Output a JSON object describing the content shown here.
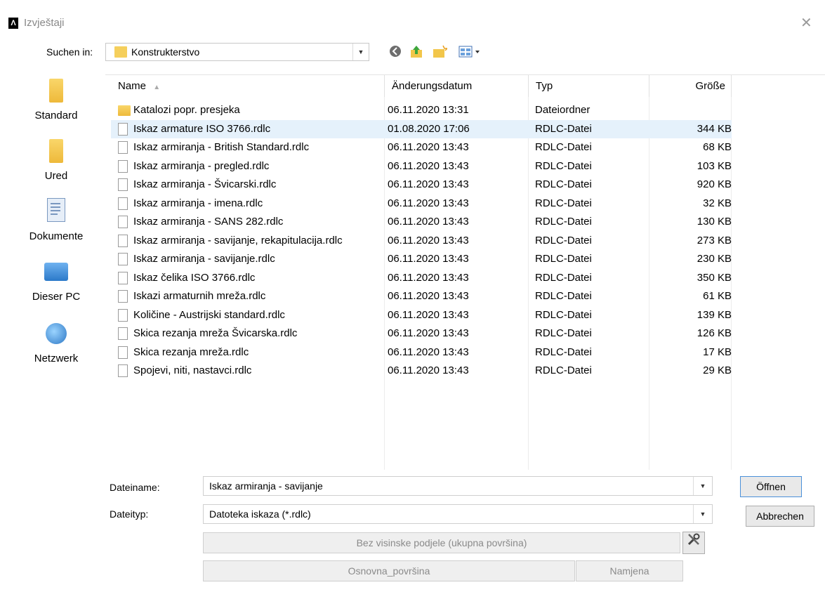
{
  "window": {
    "title": "Izvještaji",
    "app_icon": "Λ",
    "close_label": "✕"
  },
  "lookin": {
    "label": "Suchen in:",
    "value": "Konstrukterstvo"
  },
  "toolbar": {
    "back_icon": "back-icon",
    "up_icon": "up-folder-icon",
    "newfolder_icon": "new-folder-icon",
    "view_icon": "view-menu-icon"
  },
  "places": [
    {
      "label": "Standard",
      "icon": "folder-icon"
    },
    {
      "label": "Ured",
      "icon": "folder-icon"
    },
    {
      "label": "Dokumente",
      "icon": "documents-icon"
    },
    {
      "label": "Dieser PC",
      "icon": "computer-icon"
    },
    {
      "label": "Netzwerk",
      "icon": "network-icon"
    }
  ],
  "columns": {
    "name": "Name",
    "date": "Änderungsdatum",
    "type": "Typ",
    "size": "Größe"
  },
  "files": [
    {
      "name": "Katalozi popr. presjeka",
      "date": "06.11.2020 13:31",
      "type": "Dateiordner",
      "size": "",
      "kind": "folder"
    },
    {
      "name": "Iskaz armature ISO 3766.rdlc",
      "date": "01.08.2020 17:06",
      "type": "RDLC-Datei",
      "size": "344 KB",
      "kind": "file"
    },
    {
      "name": "Iskaz armiranja -  British Standard.rdlc",
      "date": "06.11.2020 13:43",
      "type": "RDLC-Datei",
      "size": "68 KB",
      "kind": "file"
    },
    {
      "name": "Iskaz armiranja -  pregled.rdlc",
      "date": "06.11.2020 13:43",
      "type": "RDLC-Datei",
      "size": "103 KB",
      "kind": "file"
    },
    {
      "name": "Iskaz armiranja -  Švicarski.rdlc",
      "date": "06.11.2020 13:43",
      "type": "RDLC-Datei",
      "size": "920 KB",
      "kind": "file"
    },
    {
      "name": "Iskaz armiranja - imena.rdlc",
      "date": "06.11.2020 13:43",
      "type": "RDLC-Datei",
      "size": "32 KB",
      "kind": "file"
    },
    {
      "name": "Iskaz armiranja - SANS 282.rdlc",
      "date": "06.11.2020 13:43",
      "type": "RDLC-Datei",
      "size": "130 KB",
      "kind": "file"
    },
    {
      "name": "Iskaz armiranja - savijanje, rekapitulacija.rdlc",
      "date": "06.11.2020 13:43",
      "type": "RDLC-Datei",
      "size": "273 KB",
      "kind": "file"
    },
    {
      "name": "Iskaz armiranja - savijanje.rdlc",
      "date": "06.11.2020 13:43",
      "type": "RDLC-Datei",
      "size": "230 KB",
      "kind": "file"
    },
    {
      "name": "Iskaz čelika ISO 3766.rdlc",
      "date": "06.11.2020 13:43",
      "type": "RDLC-Datei",
      "size": "350 KB",
      "kind": "file"
    },
    {
      "name": "Iskazi armaturnih mreža.rdlc",
      "date": "06.11.2020 13:43",
      "type": "RDLC-Datei",
      "size": "61 KB",
      "kind": "file"
    },
    {
      "name": "Količine - Austrijski standard.rdlc",
      "date": "06.11.2020 13:43",
      "type": "RDLC-Datei",
      "size": "139 KB",
      "kind": "file"
    },
    {
      "name": "Skica rezanja mreža Švicarska.rdlc",
      "date": "06.11.2020 13:43",
      "type": "RDLC-Datei",
      "size": "126 KB",
      "kind": "file"
    },
    {
      "name": "Skica rezanja mreža.rdlc",
      "date": "06.11.2020 13:43",
      "type": "RDLC-Datei",
      "size": "17 KB",
      "kind": "file"
    },
    {
      "name": "Spojevi, niti, nastavci.rdlc",
      "date": "06.11.2020 13:43",
      "type": "RDLC-Datei",
      "size": "29 KB",
      "kind": "file"
    }
  ],
  "selected_row": 1,
  "filename": {
    "label": "Dateiname:",
    "value": "Iskaz armiranja - savijanje"
  },
  "filetype": {
    "label": "Dateityp:",
    "value": "Datoteka iskaza (*.rdlc)"
  },
  "buttons": {
    "open": "Öffnen",
    "cancel": "Abbrechen"
  },
  "extra": {
    "height_option": "Bez visinske podjele (ukupna površina)",
    "base_area": "Osnovna_površina",
    "purpose": "Namjena"
  }
}
